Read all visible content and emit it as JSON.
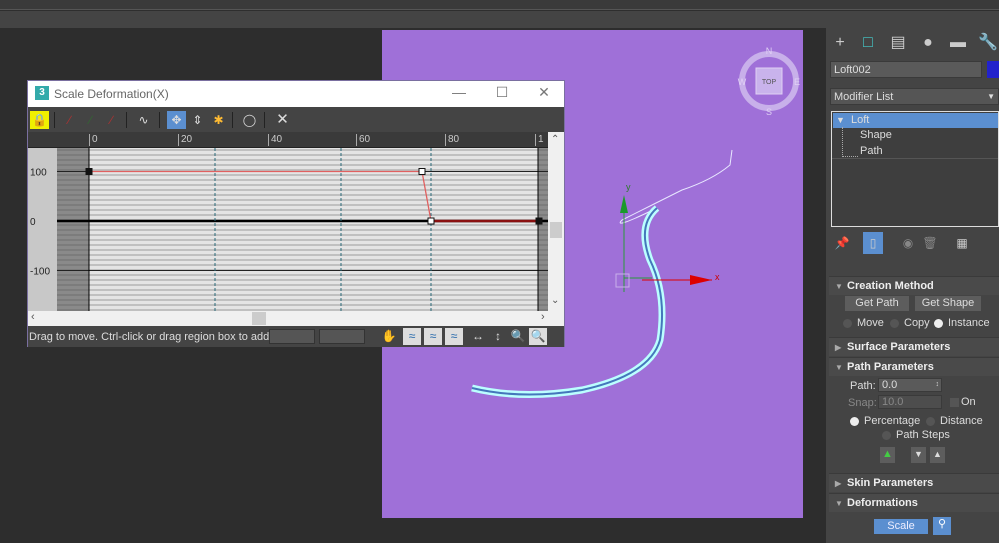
{
  "dialog": {
    "title": "Scale Deformation(X)",
    "app_icon": "3",
    "ruler_ticks": [
      "0",
      "20",
      "40",
      "60",
      "80",
      "1"
    ],
    "y_labels": [
      "100",
      "0",
      "-100"
    ],
    "status_message": "Drag to move. Ctrl-click or drag region box to add to",
    "toolbar_icons": [
      "make-symmetrical-icon",
      "display-x-axis-icon",
      "display-y-axis-icon",
      "display-xy-axes-icon",
      "swap-curves-icon",
      "move-control-point-icon",
      "scale-control-point-icon",
      "insert-corner-point-icon",
      "delete-control-point-icon",
      "reset-curve-icon"
    ],
    "curve": {
      "x_range": [
        0,
        100
      ],
      "points": [
        {
          "x": 0,
          "y": 100
        },
        {
          "x": 74,
          "y": 100
        },
        {
          "x": 76,
          "y": 0
        },
        {
          "x": 100,
          "y": 0
        }
      ],
      "shape_markers": [
        28,
        56,
        76
      ],
      "color": "#e06060"
    }
  },
  "viewport": {
    "background": "#9f70d8",
    "viewcube_label": "TOP",
    "compass": {
      "n": "N",
      "s": "S",
      "e": "E",
      "w": "W"
    },
    "axis_x": "x",
    "axis_y": "y"
  },
  "panel": {
    "object_name": "Loft002",
    "object_color": "#2222cc",
    "modifier_list": "Modifier List",
    "stack": [
      "Loft",
      "Shape",
      "Path"
    ],
    "creation_method": {
      "title": "Creation Method",
      "get_path": "Get Path",
      "get_shape": "Get Shape",
      "move": "Move",
      "copy": "Copy",
      "instance": "Instance"
    },
    "surface_parameters": "Surface Parameters",
    "path_parameters": {
      "title": "Path Parameters",
      "path_label": "Path:",
      "path_value": "0.0",
      "snap_label": "Snap:",
      "snap_value": "10.0",
      "on_label": "On",
      "percentage": "Percentage",
      "distance": "Distance",
      "path_steps": "Path Steps"
    },
    "skin_parameters": "Skin Parameters",
    "deformations": {
      "title": "Deformations",
      "scale": "Scale"
    }
  }
}
